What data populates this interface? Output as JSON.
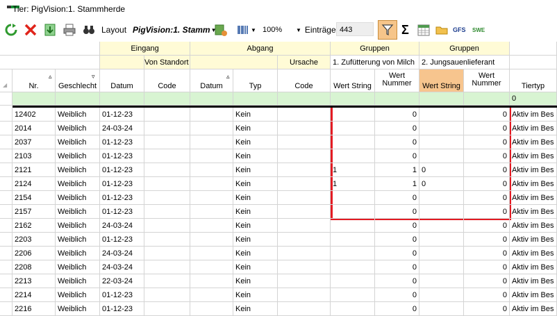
{
  "window": {
    "title": "Tier: PigVision:1. Stammherde"
  },
  "toolbar": {
    "layout_label": "Layout",
    "layout_name": "PigVision:1. Stamm",
    "zoom": "100%",
    "entries_label": "Einträge",
    "entries_count": "443",
    "sigma": "Σ",
    "gfs": "GFS",
    "swe": "SWE",
    "icons": [
      "refresh-icon",
      "close-icon",
      "export-icon",
      "print-icon",
      "binoculars-icon",
      "layout-icon",
      "barcode-icon",
      "filter-icon",
      "sum-icon",
      "calendar-icon",
      "folder-icon",
      "gfs-icon",
      "swe-icon"
    ]
  },
  "header": {
    "groups": {
      "eingang": "Eingang",
      "abgang": "Abgang",
      "gruppen1": "Gruppen",
      "gruppen2": "Gruppen"
    },
    "subgroups": {
      "von_standort": "Von Standort",
      "ursache": "Ursache",
      "gruppe1_name": "1. Zufütterung von Milch",
      "gruppe2_name": "2. Jungsauenlieferant"
    },
    "columns": {
      "nr": "Nr.",
      "geschlecht": "Geschlecht",
      "datum_in": "Datum",
      "code_in": "Code",
      "datum_out": "Datum",
      "typ": "Typ",
      "code_out": "Code",
      "wert_string1": "Wert String",
      "wert_nummer1": "Wert Nummer",
      "wert_string2": "Wert String",
      "wert_nummer2": "Wert Nummer",
      "tiertyp": "Tiertyp"
    },
    "filter_row": {
      "tiertyp": "0"
    }
  },
  "colors": {
    "highlight": "#e31b23",
    "yellow_header": "#fffbd6",
    "filter_row": "#d8f4d2",
    "active_column": "#f7c58e"
  },
  "rows": [
    {
      "nr": "12402",
      "geschlecht": "Weiblich",
      "datum": "01-12-23",
      "typ": "Kein",
      "ws1": "",
      "wn1": "0",
      "ws2": "",
      "wn2": "0",
      "tiertyp": "Aktiv im Bes"
    },
    {
      "nr": "2014",
      "geschlecht": "Weiblich",
      "datum": "24-03-24",
      "typ": "Kein",
      "ws1": "",
      "wn1": "0",
      "ws2": "",
      "wn2": "0",
      "tiertyp": "Aktiv im Bes"
    },
    {
      "nr": "2037",
      "geschlecht": "Weiblich",
      "datum": "01-12-23",
      "typ": "Kein",
      "ws1": "",
      "wn1": "0",
      "ws2": "",
      "wn2": "0",
      "tiertyp": "Aktiv im Bes"
    },
    {
      "nr": "2103",
      "geschlecht": "Weiblich",
      "datum": "01-12-23",
      "typ": "Kein",
      "ws1": "",
      "wn1": "0",
      "ws2": "",
      "wn2": "0",
      "tiertyp": "Aktiv im Bes"
    },
    {
      "nr": "2121",
      "geschlecht": "Weiblich",
      "datum": "01-12-23",
      "typ": "Kein",
      "ws1": "1",
      "wn1": "1",
      "ws2": "0",
      "wn2": "0",
      "tiertyp": "Aktiv im Bes"
    },
    {
      "nr": "2124",
      "geschlecht": "Weiblich",
      "datum": "01-12-23",
      "typ": "Kein",
      "ws1": "1",
      "wn1": "1",
      "ws2": "0",
      "wn2": "0",
      "tiertyp": "Aktiv im Bes"
    },
    {
      "nr": "2154",
      "geschlecht": "Weiblich",
      "datum": "01-12-23",
      "typ": "Kein",
      "ws1": "",
      "wn1": "0",
      "ws2": "",
      "wn2": "0",
      "tiertyp": "Aktiv im Bes"
    },
    {
      "nr": "2157",
      "geschlecht": "Weiblich",
      "datum": "01-12-23",
      "typ": "Kein",
      "ws1": "",
      "wn1": "0",
      "ws2": "",
      "wn2": "0",
      "tiertyp": "Aktiv im Bes"
    },
    {
      "nr": "2162",
      "geschlecht": "Weiblich",
      "datum": "24-03-24",
      "typ": "Kein",
      "ws1": "",
      "wn1": "0",
      "ws2": "",
      "wn2": "0",
      "tiertyp": "Aktiv im Bes"
    },
    {
      "nr": "2203",
      "geschlecht": "Weiblich",
      "datum": "01-12-23",
      "typ": "Kein",
      "ws1": "",
      "wn1": "0",
      "ws2": "",
      "wn2": "0",
      "tiertyp": "Aktiv im Bes"
    },
    {
      "nr": "2206",
      "geschlecht": "Weiblich",
      "datum": "24-03-24",
      "typ": "Kein",
      "ws1": "",
      "wn1": "0",
      "ws2": "",
      "wn2": "0",
      "tiertyp": "Aktiv im Bes"
    },
    {
      "nr": "2208",
      "geschlecht": "Weiblich",
      "datum": "24-03-24",
      "typ": "Kein",
      "ws1": "",
      "wn1": "0",
      "ws2": "",
      "wn2": "0",
      "tiertyp": "Aktiv im Bes"
    },
    {
      "nr": "2213",
      "geschlecht": "Weiblich",
      "datum": "22-03-24",
      "typ": "Kein",
      "ws1": "",
      "wn1": "0",
      "ws2": "",
      "wn2": "0",
      "tiertyp": "Aktiv im Bes"
    },
    {
      "nr": "2214",
      "geschlecht": "Weiblich",
      "datum": "01-12-23",
      "typ": "Kein",
      "ws1": "",
      "wn1": "0",
      "ws2": "",
      "wn2": "0",
      "tiertyp": "Aktiv im Bes"
    },
    {
      "nr": "2216",
      "geschlecht": "Weiblich",
      "datum": "01-12-23",
      "typ": "Kein",
      "ws1": "",
      "wn1": "0",
      "ws2": "",
      "wn2": "0",
      "tiertyp": "Aktiv im Bes"
    }
  ]
}
